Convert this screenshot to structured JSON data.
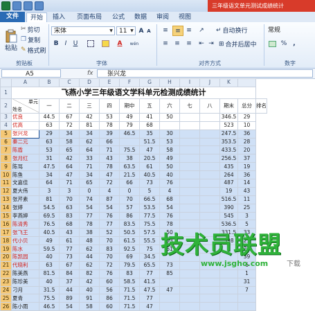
{
  "window": {
    "title": "三年级语文单元测试成绩统计"
  },
  "tabs": [
    {
      "label": "文件"
    },
    {
      "label": "开始"
    },
    {
      "label": "插入"
    },
    {
      "label": "页面布局"
    },
    {
      "label": "公式"
    },
    {
      "label": "数据"
    },
    {
      "label": "审阅"
    },
    {
      "label": "视图"
    }
  ],
  "ribbon": {
    "clipboard": {
      "paste": "粘贴",
      "cut": "剪切",
      "copy": "复制",
      "format_painter": "格式刷",
      "label": "剪贴板"
    },
    "font": {
      "name": "宋体",
      "size": "11",
      "label": "字体",
      "grow": "A",
      "shrink": "A",
      "bold": "B",
      "italic": "I",
      "underline": "U",
      "color": "A",
      "wen": "wén"
    },
    "alignment": {
      "wrap": "自动换行",
      "merge": "合并后居中",
      "label": "对齐方式"
    },
    "number": {
      "format": "常规",
      "label": "数字",
      "currency": "%",
      "comma": ","
    }
  },
  "formula_bar": {
    "name_box": "A5",
    "fx": "fx",
    "value": "张兴龙"
  },
  "columns": [
    "A",
    "B",
    "C",
    "D",
    "E",
    "F",
    "G",
    "H",
    "I",
    "J",
    "K"
  ],
  "sheet": {
    "title": "飞燕小学三年级语文学科单元检测成绩统计",
    "header": {
      "unit": "单元",
      "name": "姓名",
      "cols": [
        "一",
        "二",
        "三",
        "四",
        "期中",
        "五",
        "六",
        "七",
        "八",
        "期末",
        "总分",
        "排名"
      ]
    },
    "rows": [
      {
        "n": "3",
        "c": [
          "优良",
          "44.5",
          "67",
          "42",
          "53",
          "49",
          "41",
          "50",
          "",
          "",
          "346.5",
          "29"
        ],
        "red": true
      },
      {
        "n": "4",
        "c": [
          "优高",
          "63",
          "72",
          "81",
          "78",
          "79",
          "68",
          "",
          "",
          "",
          "523",
          "10"
        ],
        "red": true
      },
      {
        "n": "5",
        "c": [
          "张兴龙",
          "29",
          "34",
          "34",
          "39",
          "46.5",
          "35",
          "30",
          "",
          "",
          "247.5",
          "36"
        ],
        "red": true,
        "sel": true
      },
      {
        "n": "6",
        "c": [
          "秦二元",
          "63",
          "58",
          "62",
          "66",
          "",
          "51.5",
          "53",
          "",
          "",
          "353.5",
          "28"
        ],
        "red": true,
        "sel": true
      },
      {
        "n": "7",
        "c": [
          "陈盾",
          "53",
          "65",
          "64",
          "71",
          "75.5",
          "47",
          "58",
          "",
          "",
          "433.5",
          "20"
        ],
        "red": true,
        "sel": true
      },
      {
        "n": "8",
        "c": [
          "张月红",
          "31",
          "42",
          "33",
          "43",
          "38",
          "20.5",
          "49",
          "",
          "",
          "256.5",
          "37"
        ],
        "red": true,
        "sel": true
      },
      {
        "n": "9",
        "c": [
          "陈骂",
          "47.5",
          "64",
          "71",
          "78",
          "63.5",
          "61",
          "50",
          "",
          "",
          "435",
          "19"
        ],
        "red": false,
        "sel": true
      },
      {
        "n": "10",
        "c": [
          "陈鱼",
          "34",
          "47",
          "34",
          "47",
          "21.5",
          "40.5",
          "40",
          "",
          "",
          "264",
          "36"
        ],
        "red": false,
        "sel": true
      },
      {
        "n": "11",
        "c": [
          "文嘉佳",
          "64",
          "71",
          "65",
          "72",
          "66",
          "73",
          "76",
          "",
          "",
          "487",
          "14"
        ],
        "red": false,
        "sel": true
      },
      {
        "n": "12",
        "c": [
          "夏大伟",
          "3",
          "3",
          "0",
          "4",
          "0",
          "5",
          "4",
          "",
          "",
          "19",
          "43"
        ],
        "red": false,
        "sel": true
      },
      {
        "n": "13",
        "c": [
          "张芹素",
          "81",
          "70",
          "74",
          "87",
          "70",
          "66.5",
          "68",
          "",
          "",
          "516.5",
          "11"
        ],
        "red": false,
        "sel": true
      },
      {
        "n": "14",
        "c": [
          "张婷",
          "54.5",
          "63",
          "54",
          "54",
          "57",
          "53.5",
          "54",
          "",
          "",
          "390",
          "25"
        ],
        "red": false,
        "sel": true
      },
      {
        "n": "15",
        "c": [
          "李燕婷",
          "69.5",
          "83",
          "77",
          "76",
          "86",
          "77.5",
          "76",
          "",
          "",
          "545",
          "3"
        ],
        "red": false,
        "sel": true
      },
      {
        "n": "16",
        "c": [
          "陈清秀",
          "76.5",
          "68",
          "78",
          "77",
          "83.5",
          "75.5",
          "78",
          "",
          "",
          "536.5",
          "5"
        ],
        "red": true,
        "sel": true
      },
      {
        "n": "17",
        "c": [
          "张飞王",
          "40.5",
          "43",
          "38",
          "52",
          "50.5",
          "57.5",
          "50",
          "",
          "",
          "331.5",
          "33"
        ],
        "red": true,
        "sel": true
      },
      {
        "n": "18",
        "c": [
          "代小贝",
          "49",
          "61",
          "48",
          "70",
          "61.5",
          "55.5",
          "53",
          "",
          "",
          "398",
          "23"
        ],
        "red": true,
        "sel": true
      },
      {
        "n": "19",
        "c": [
          "陈水",
          "59.5",
          "77",
          "62",
          "83",
          "92.5",
          "75",
          "61",
          "",
          "",
          "",
          "25"
        ],
        "red": true,
        "sel": true
      },
      {
        "n": "20",
        "c": [
          "陈凯园",
          "40",
          "73",
          "44",
          "70",
          "69",
          "34.5",
          "",
          "",
          "",
          "",
          "39"
        ],
        "red": true,
        "sel": true
      },
      {
        "n": "21",
        "c": [
          "代晓利",
          "63",
          "67",
          "62",
          "72",
          "79.5",
          "65.5",
          "73",
          "",
          "",
          "",
          "6"
        ],
        "red": true,
        "sel": true
      },
      {
        "n": "22",
        "c": [
          "陈美燕",
          "81.5",
          "84",
          "82",
          "76",
          "83",
          "77",
          "85",
          "",
          "",
          "",
          "1"
        ],
        "red": false,
        "sel": true
      },
      {
        "n": "23",
        "c": [
          "陈珍美",
          "40",
          "37",
          "42",
          "60",
          "58.5",
          "41.5",
          "",
          "",
          "",
          "",
          "31"
        ],
        "red": false,
        "sel": true
      },
      {
        "n": "24",
        "c": [
          "刁月",
          "31.5",
          "44",
          "40",
          "56",
          "71.5",
          "47.5",
          "47",
          "",
          "",
          "",
          "7"
        ],
        "red": false,
        "sel": true
      },
      {
        "n": "25",
        "c": [
          "夏青",
          "75.5",
          "89",
          "91",
          "86",
          "71.5",
          "77",
          "",
          "",
          "",
          "",
          ""
        ],
        "red": false,
        "sel": true
      },
      {
        "n": "26",
        "c": [
          "陈小雨",
          "46.5",
          "54",
          "58",
          "60",
          "71.5",
          "47",
          "",
          "",
          "",
          "",
          ""
        ],
        "red": false,
        "sel": true
      }
    ]
  },
  "watermark": {
    "main": "技术员联盟",
    "url": "www.jsgho.com",
    "mark": "下载"
  },
  "colors": {
    "accent": "#2a6bb5",
    "title_red": "#d83b2a",
    "selection": "#cfe0f6",
    "watermark_green": "#2fb23a"
  }
}
